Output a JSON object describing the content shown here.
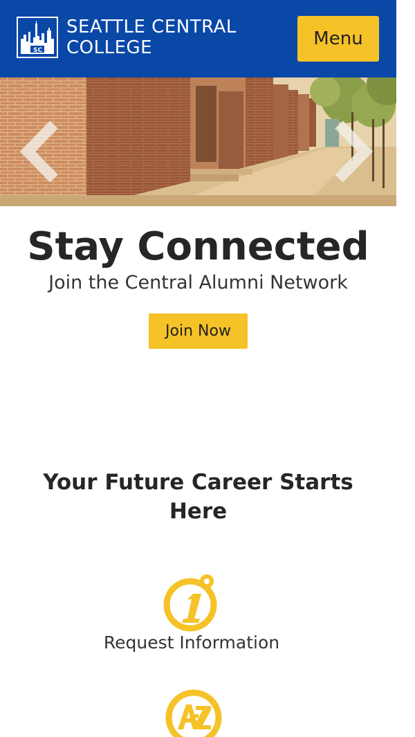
{
  "header": {
    "logo_line1": "SEATTLE CENTRAL",
    "logo_line2": "COLLEGE",
    "menu_label": "Menu",
    "brand_color": "#0a48a8",
    "accent_color": "#f5c227"
  },
  "hero": {
    "prev_icon": "chevron-left-icon",
    "next_icon": "chevron-right-icon"
  },
  "promo": {
    "title": "Stay Connected",
    "subtitle": "Join the Central Alumni Network",
    "button_label": "Join Now"
  },
  "career": {
    "title": "Your Future Career Starts Here",
    "links": [
      {
        "label": "Request Information",
        "icon": "info-icon"
      },
      {
        "label": "",
        "icon": "a-z-index-icon"
      }
    ]
  }
}
